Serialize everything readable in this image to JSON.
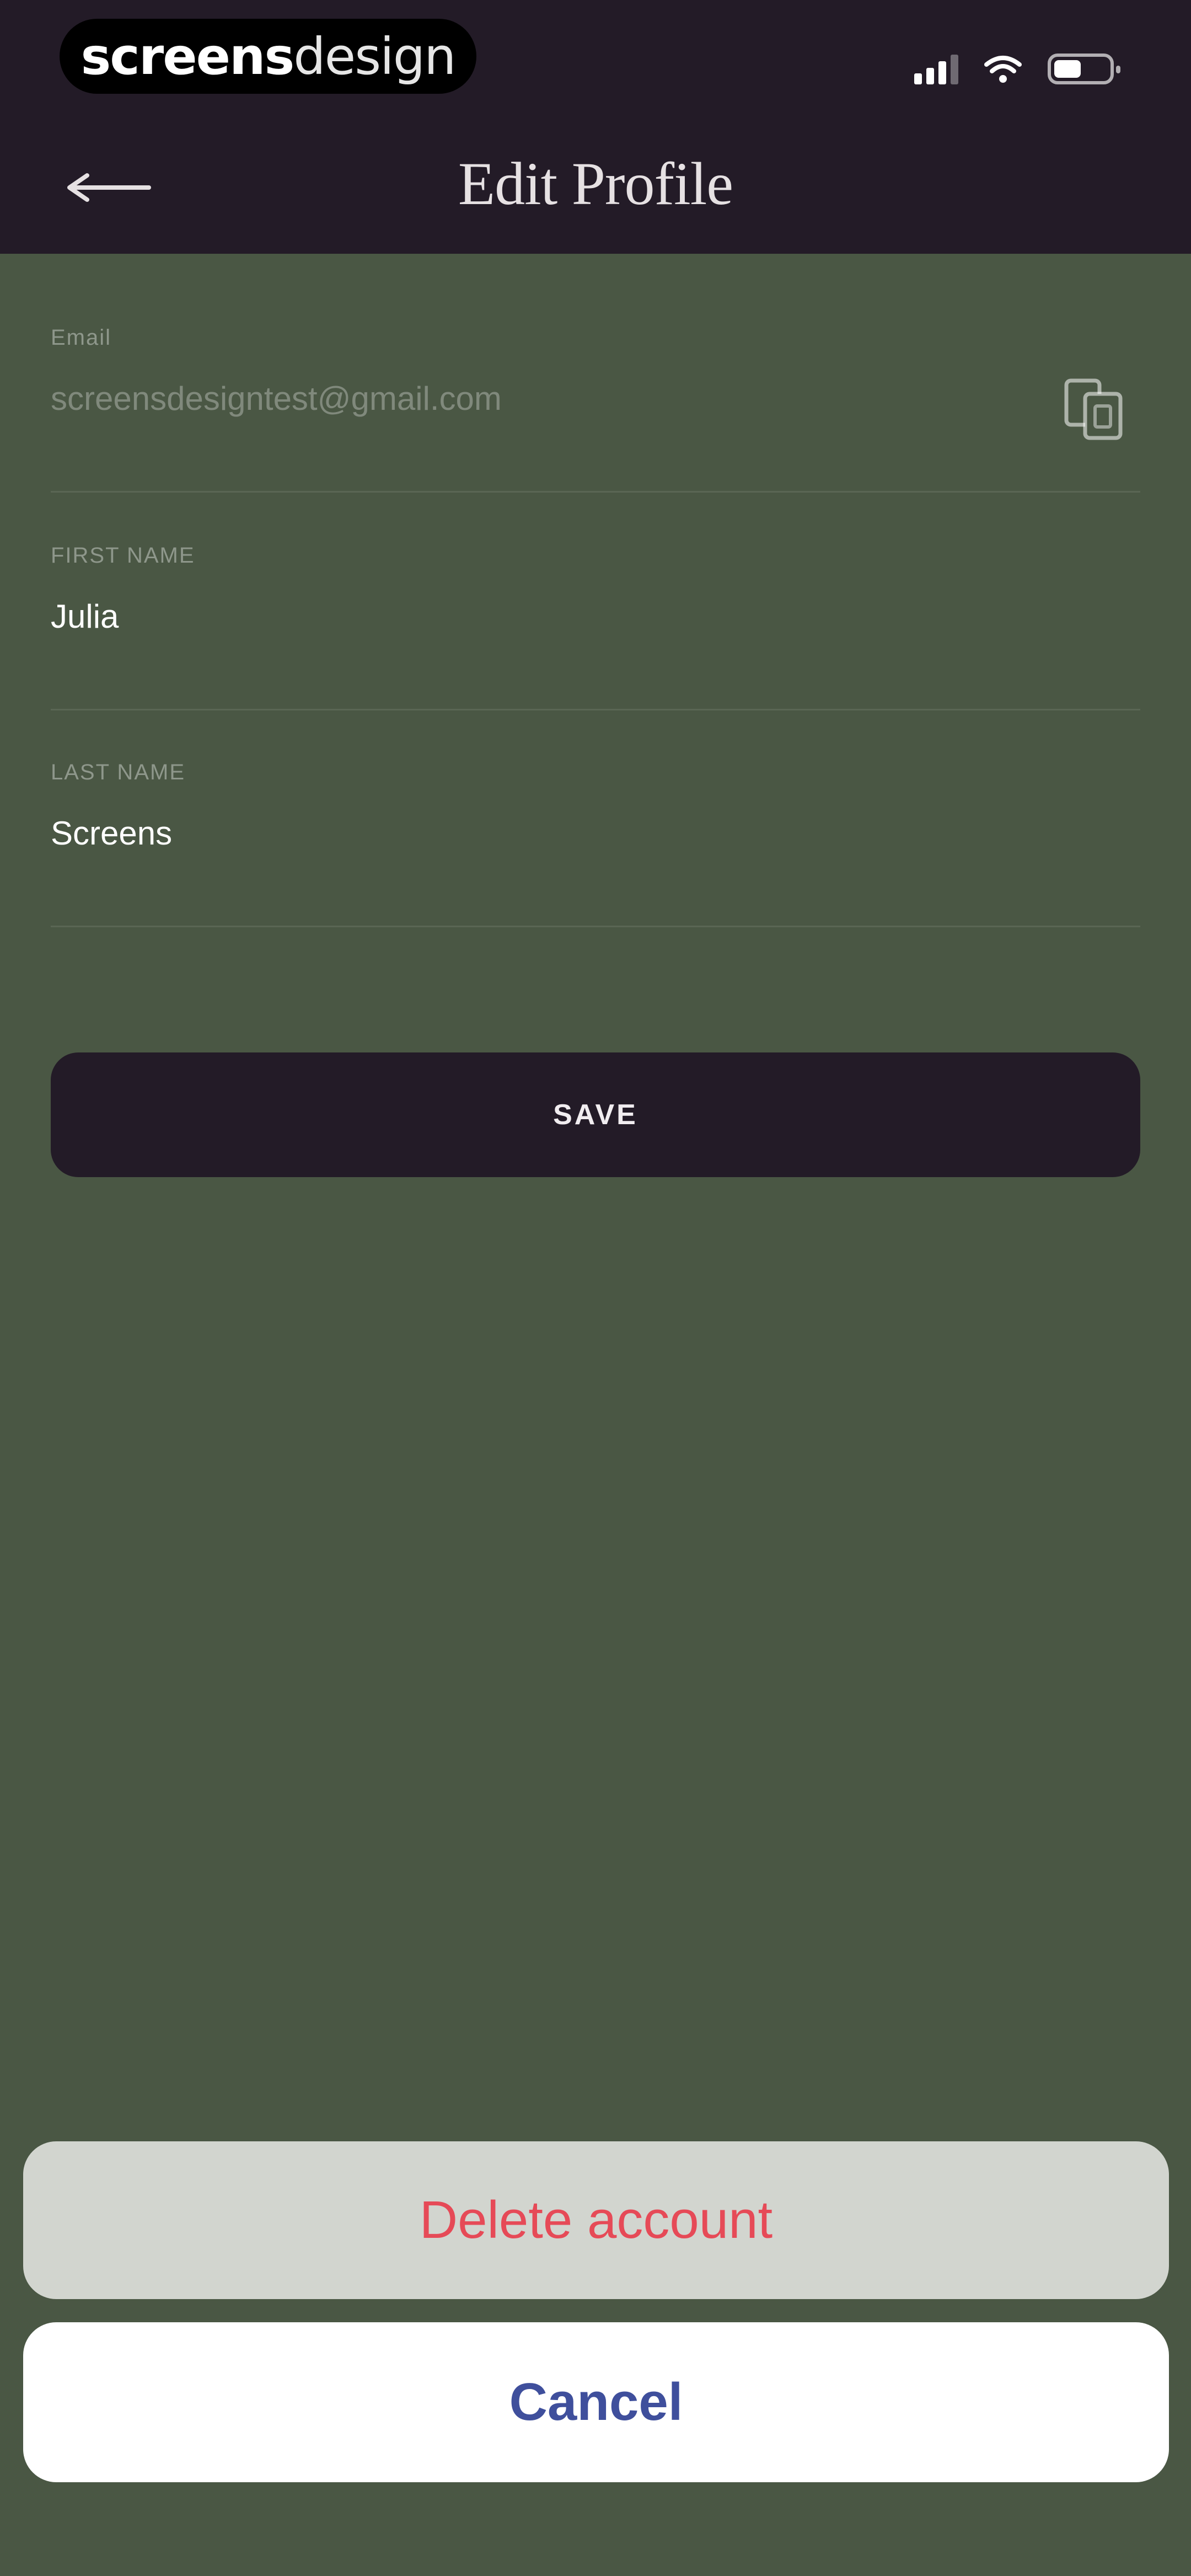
{
  "status_bar": {
    "brand_left": "screens",
    "brand_right": "design",
    "signal_icon": "cellular-signal-icon",
    "wifi_icon": "wifi-icon",
    "battery_icon": "battery-icon",
    "battery_level_percent": 50
  },
  "nav": {
    "title": "Edit Profile",
    "back_icon": "arrow-left-icon"
  },
  "form": {
    "email": {
      "label": "Email",
      "value": "screensdesigntest@gmail.com",
      "copy_icon": "copy-icon"
    },
    "first_name": {
      "label": "FIRST NAME",
      "value": "Julia"
    },
    "last_name": {
      "label": "LAST NAME",
      "value": "Screens"
    },
    "save_label": "SAVE"
  },
  "action_sheet": {
    "delete_label": "Delete account",
    "cancel_label": "Cancel"
  },
  "colors": {
    "header_bg": "#231b27",
    "page_bg": "#4a5744",
    "delete_text": "#e64a57",
    "cancel_text": "#3f4f9c"
  }
}
